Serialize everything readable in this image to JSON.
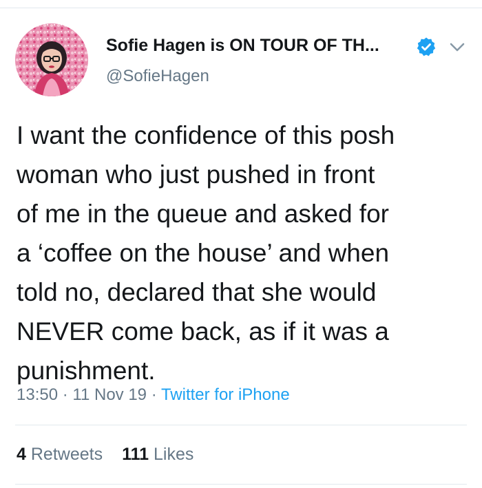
{
  "tweet": {
    "author_name": "Sofie Hagen is ON TOUR OF TH...",
    "handle": "@SofieHagen",
    "text": "I want the confidence of this posh\nwoman who just pushed in front\nof me in the queue and asked for\na ‘coffee on the house’ and when\ntold no, declared that she would\nNEVER come back, as if it was a\npunishment.",
    "time": "13:50",
    "date": "11 Nov 19",
    "separator": "·",
    "source": "Twitter for iPhone",
    "retweets_count": "4",
    "retweets_label": "Retweets",
    "likes_count": "111",
    "likes_label": "Likes"
  },
  "icons": {
    "verified": "verified-badge-icon",
    "menu": "chevron-down-icon"
  },
  "colors": {
    "text": "#14171a",
    "secondary": "#657786",
    "link": "#1da1f2",
    "divider": "#e1e8ed",
    "verified": "#1da1f2"
  }
}
